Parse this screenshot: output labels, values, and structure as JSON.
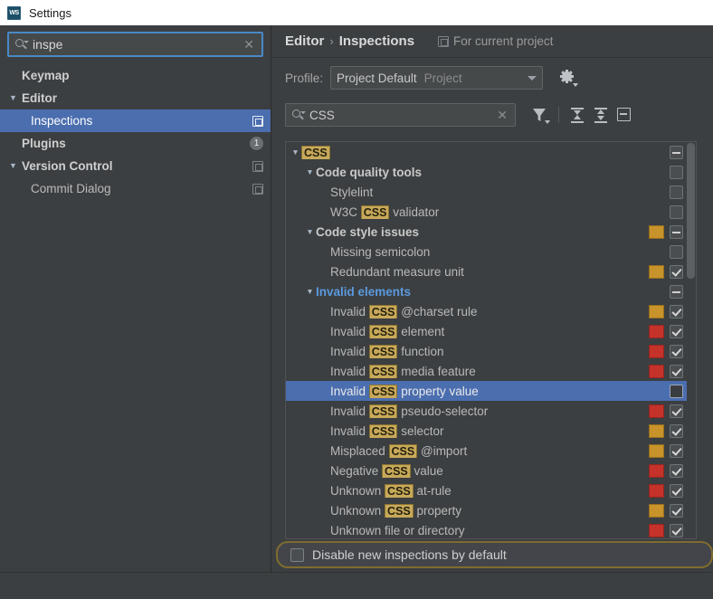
{
  "window": {
    "title": "Settings",
    "app_icon": "webstorm-icon",
    "icon_text": "WS"
  },
  "sidebar": {
    "search": {
      "value": "inspe",
      "placeholder": "",
      "icon": "search-icon",
      "clear_icon": "close-icon"
    },
    "items": [
      {
        "label": "Keymap",
        "indent": 0,
        "bold": true,
        "arrow": "",
        "selected": false,
        "trailing": ""
      },
      {
        "label": "Editor",
        "indent": 0,
        "bold": true,
        "arrow": "▼",
        "selected": false,
        "trailing": ""
      },
      {
        "label": "Inspections",
        "indent": 1,
        "bold": false,
        "arrow": "",
        "selected": true,
        "trailing": "scope"
      },
      {
        "label": "Plugins",
        "indent": 0,
        "bold": true,
        "arrow": "",
        "selected": false,
        "trailing": "badge",
        "badge": "1"
      },
      {
        "label": "Version Control",
        "indent": 0,
        "bold": true,
        "arrow": "▼",
        "selected": false,
        "trailing": "scope"
      },
      {
        "label": "Commit Dialog",
        "indent": 1,
        "bold": false,
        "arrow": "",
        "selected": false,
        "trailing": "scope"
      }
    ]
  },
  "header": {
    "breadcrumb_parent": "Editor",
    "breadcrumb_sep": "›",
    "breadcrumb_current": "Inspections",
    "scope_label": "For current project",
    "scope_icon": "project-scope-icon"
  },
  "profile": {
    "label": "Profile:",
    "value": "Project Default",
    "value_suffix": "Project",
    "dropdown_icon": "chevron-down-icon",
    "gear_icon": "gear-icon"
  },
  "toolbar": {
    "search": {
      "value": "CSS",
      "placeholder": "",
      "icon": "search-icon",
      "clear_icon": "close-icon"
    },
    "filter_icon": "filter-funnel-icon",
    "expand_all_icon": "expand-all-icon",
    "collapse_all_icon": "collapse-all-icon",
    "show_only_enabled_icon": "show-only-enabled-icon"
  },
  "colors": {
    "warning": "#c8932a",
    "error": "#c5322a",
    "selection": "#4b6eaf",
    "highlight_match": "#c8a95a",
    "link_blue": "#5a9adf",
    "band_border": "#7f6c2e"
  },
  "tree": {
    "rows": [
      {
        "indent": 0,
        "arrow": "▼",
        "pre": "",
        "match": "CSS",
        "post": "",
        "group": true,
        "blue": false,
        "selected": false,
        "severity": "none",
        "checkbox": "dash"
      },
      {
        "indent": 1,
        "arrow": "▼",
        "pre": "Code quality tools",
        "match": "",
        "post": "",
        "group": true,
        "blue": false,
        "selected": false,
        "severity": "none",
        "checkbox": "empty"
      },
      {
        "indent": 2,
        "arrow": "",
        "pre": "Stylelint",
        "match": "",
        "post": "",
        "group": false,
        "blue": false,
        "selected": false,
        "severity": "none",
        "checkbox": "empty"
      },
      {
        "indent": 2,
        "arrow": "",
        "pre": "W3C ",
        "match": "CSS",
        "post": " validator",
        "group": false,
        "blue": false,
        "selected": false,
        "severity": "none",
        "checkbox": "empty"
      },
      {
        "indent": 1,
        "arrow": "▼",
        "pre": "Code style issues",
        "match": "",
        "post": "",
        "group": true,
        "blue": false,
        "selected": false,
        "severity": "warning",
        "checkbox": "dash"
      },
      {
        "indent": 2,
        "arrow": "",
        "pre": "Missing semicolon",
        "match": "",
        "post": "",
        "group": false,
        "blue": false,
        "selected": false,
        "severity": "none",
        "checkbox": "empty"
      },
      {
        "indent": 2,
        "arrow": "",
        "pre": "Redundant measure unit",
        "match": "",
        "post": "",
        "group": false,
        "blue": false,
        "selected": false,
        "severity": "warning",
        "checkbox": "checked"
      },
      {
        "indent": 1,
        "arrow": "▼",
        "pre": "Invalid elements",
        "match": "",
        "post": "",
        "group": true,
        "blue": true,
        "selected": false,
        "severity": "none",
        "checkbox": "dash"
      },
      {
        "indent": 2,
        "arrow": "",
        "pre": "Invalid ",
        "match": "CSS",
        "post": " @charset rule",
        "group": false,
        "blue": false,
        "selected": false,
        "severity": "warning",
        "checkbox": "checked"
      },
      {
        "indent": 2,
        "arrow": "",
        "pre": "Invalid ",
        "match": "CSS",
        "post": " element",
        "group": false,
        "blue": false,
        "selected": false,
        "severity": "error",
        "checkbox": "checked"
      },
      {
        "indent": 2,
        "arrow": "",
        "pre": "Invalid ",
        "match": "CSS",
        "post": " function",
        "group": false,
        "blue": false,
        "selected": false,
        "severity": "error",
        "checkbox": "checked"
      },
      {
        "indent": 2,
        "arrow": "",
        "pre": "Invalid ",
        "match": "CSS",
        "post": " media feature",
        "group": false,
        "blue": false,
        "selected": false,
        "severity": "error",
        "checkbox": "checked"
      },
      {
        "indent": 2,
        "arrow": "",
        "pre": "Invalid ",
        "match": "CSS",
        "post": " property value",
        "group": false,
        "blue": false,
        "selected": true,
        "severity": "none",
        "checkbox": "focus"
      },
      {
        "indent": 2,
        "arrow": "",
        "pre": "Invalid ",
        "match": "CSS",
        "post": " pseudo-selector",
        "group": false,
        "blue": false,
        "selected": false,
        "severity": "error",
        "checkbox": "checked"
      },
      {
        "indent": 2,
        "arrow": "",
        "pre": "Invalid ",
        "match": "CSS",
        "post": " selector",
        "group": false,
        "blue": false,
        "selected": false,
        "severity": "warning",
        "checkbox": "checked"
      },
      {
        "indent": 2,
        "arrow": "",
        "pre": "Misplaced ",
        "match": "CSS",
        "post": " @import",
        "group": false,
        "blue": false,
        "selected": false,
        "severity": "warning",
        "checkbox": "checked"
      },
      {
        "indent": 2,
        "arrow": "",
        "pre": "Negative ",
        "match": "CSS",
        "post": " value",
        "group": false,
        "blue": false,
        "selected": false,
        "severity": "error",
        "checkbox": "checked"
      },
      {
        "indent": 2,
        "arrow": "",
        "pre": "Unknown ",
        "match": "CSS",
        "post": " at-rule",
        "group": false,
        "blue": false,
        "selected": false,
        "severity": "error",
        "checkbox": "checked"
      },
      {
        "indent": 2,
        "arrow": "",
        "pre": "Unknown ",
        "match": "CSS",
        "post": " property",
        "group": false,
        "blue": false,
        "selected": false,
        "severity": "warning",
        "checkbox": "checked"
      },
      {
        "indent": 2,
        "arrow": "",
        "pre": "Unknown file or directory",
        "match": "",
        "post": "",
        "group": false,
        "blue": false,
        "selected": false,
        "severity": "error",
        "checkbox": "checked"
      }
    ]
  },
  "bottom": {
    "disable_new_label": "Disable new inspections by default",
    "disable_new_checked": false
  }
}
